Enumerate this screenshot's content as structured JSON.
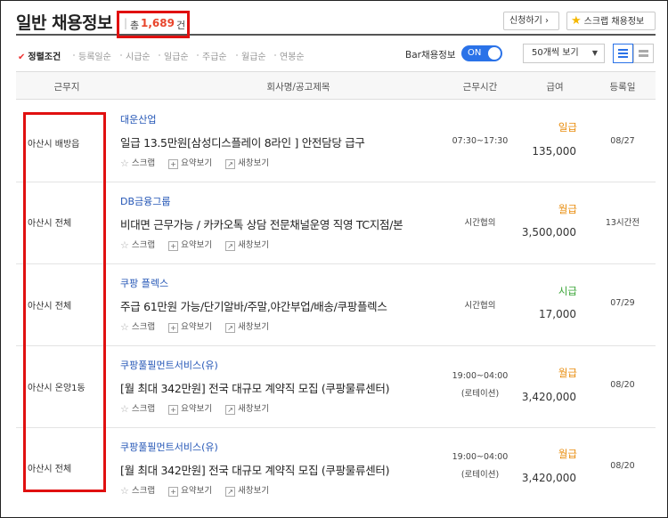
{
  "header": {
    "title": "일반 채용정보",
    "count_prefix": "총",
    "count_value": "1,689",
    "count_suffix": "건",
    "apply_label": "신청하기 ›",
    "scrap_label": "스크랩 채용정보"
  },
  "sort": {
    "items": [
      "정렬조건",
      "등록일순",
      "시급순",
      "일급순",
      "주급순",
      "월급순",
      "연봉순"
    ],
    "active_index": 0,
    "bar_label": "Bar채용정보",
    "toggle_label": "ON",
    "view_select": "50개씩 보기"
  },
  "table": {
    "headers": [
      "근무지",
      "회사명/공고제목",
      "근무시간",
      "급여",
      "등록일"
    ]
  },
  "actions": {
    "scrap": "스크랩",
    "summary": "요약보기",
    "new_window": "새창보기"
  },
  "rows": [
    {
      "location": "아산시 배방읍",
      "company": "대운산업",
      "title": "일급 13.5만원[삼성디스플레이 8라인 ] 안전담당 급구",
      "hours": [
        "07:30~17:30"
      ],
      "pay_type": "일급",
      "pay_amount": "135,000",
      "date": "08/27"
    },
    {
      "location": "아산시 전체",
      "company": "DB금융그룹",
      "title": "비대면 근무가능 / 카카오톡 상담 전문채널운영 직영 TC지점/본",
      "hours": [
        "시간협의"
      ],
      "pay_type": "월급",
      "pay_amount": "3,500,000",
      "date": "13시간전"
    },
    {
      "location": "아산시 전체",
      "company": "쿠팡 플렉스",
      "title": "주급 61만원 가능/단기알바/주말,야간부업/배송/쿠팡플렉스",
      "hours": [
        "시간협의"
      ],
      "pay_type": "시급",
      "pay_amount": "17,000",
      "date": "07/29"
    },
    {
      "location": "아산시 온양1동",
      "company": "쿠팡풀필먼트서비스(유)",
      "title": "[월 최대 342만원] 전국 대규모 계약직 모집 (쿠팡물류센터)",
      "hours": [
        "19:00~04:00",
        "(로테이션)"
      ],
      "pay_type": "월급",
      "pay_amount": "3,420,000",
      "date": "08/20"
    },
    {
      "location": "아산시 전체",
      "company": "쿠팡풀필먼트서비스(유)",
      "title": "[월 최대 342만원] 전국 대규모 계약직 모집 (쿠팡물류센터)",
      "hours": [
        "19:00~04:00",
        "(로테이션)"
      ],
      "pay_type": "월급",
      "pay_amount": "3,420,000",
      "date": "08/20"
    }
  ],
  "colors": {
    "accent_blue": "#2a72e8",
    "highlight_red": "#e01010",
    "count_red": "#e8452c",
    "pay_orange": "#e88b0a",
    "pay_green": "#3aa537",
    "company_blue": "#2456b6"
  }
}
